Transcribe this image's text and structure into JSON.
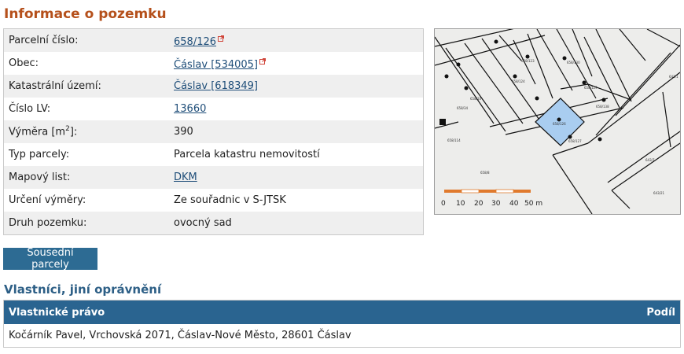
{
  "page_title": "Informace o pozemku",
  "info": [
    {
      "label": "Parcelní číslo:",
      "value": "658/126",
      "link": true,
      "external": true
    },
    {
      "label": "Obec:",
      "value": "Čáslav [534005]",
      "link": true,
      "external": true
    },
    {
      "label": "Katastrální území:",
      "value": "Čáslav [618349]",
      "link": true,
      "external": false
    },
    {
      "label": "Číslo LV:",
      "value": "13660",
      "link": true,
      "external": false
    },
    {
      "label_prefix": "Výměra [m",
      "label_sup": "2",
      "label_suffix": "]:",
      "value": "390",
      "link": false
    },
    {
      "label": "Typ parcely:",
      "value": "Parcela katastru nemovitostí",
      "link": false
    },
    {
      "label": "Mapový list:",
      "value": "DKM",
      "link": true,
      "external": false
    },
    {
      "label": "Určení výměry:",
      "value": "Ze souřadnic v S-JTSK",
      "link": false
    },
    {
      "label": "Druh pozemku:",
      "value": "ovocný sad",
      "link": false
    }
  ],
  "map": {
    "scale_labels": [
      "0",
      "10",
      "20",
      "30",
      "40",
      "50 m"
    ],
    "parcel_labels": [
      "658/126",
      "658/127",
      "658/138",
      "658/124",
      "658/123",
      "658/130",
      "658/129",
      "658/114",
      "658/8",
      "658/10",
      "658/34",
      "643/7",
      "643/21",
      "643/1"
    ]
  },
  "button_sousedni": "Sousední parcely",
  "owners_title": "Vlastníci, jiní oprávnění",
  "owners_table": {
    "header_left": "Vlastnické právo",
    "header_right": "Podíl",
    "rows": [
      "Kočárník Pavel, Vrchovská 2071, Čáslav-Nové Město, 28601 Čáslav"
    ]
  },
  "colors": {
    "title": "#b5501b",
    "section_title": "#2d5f86",
    "header_bg": "#2a6490",
    "button_bg": "#2d6b93",
    "link": "#1f4e79",
    "highlight_parcel": "#a9cdf0",
    "scale_orange": "#e07a2d"
  }
}
